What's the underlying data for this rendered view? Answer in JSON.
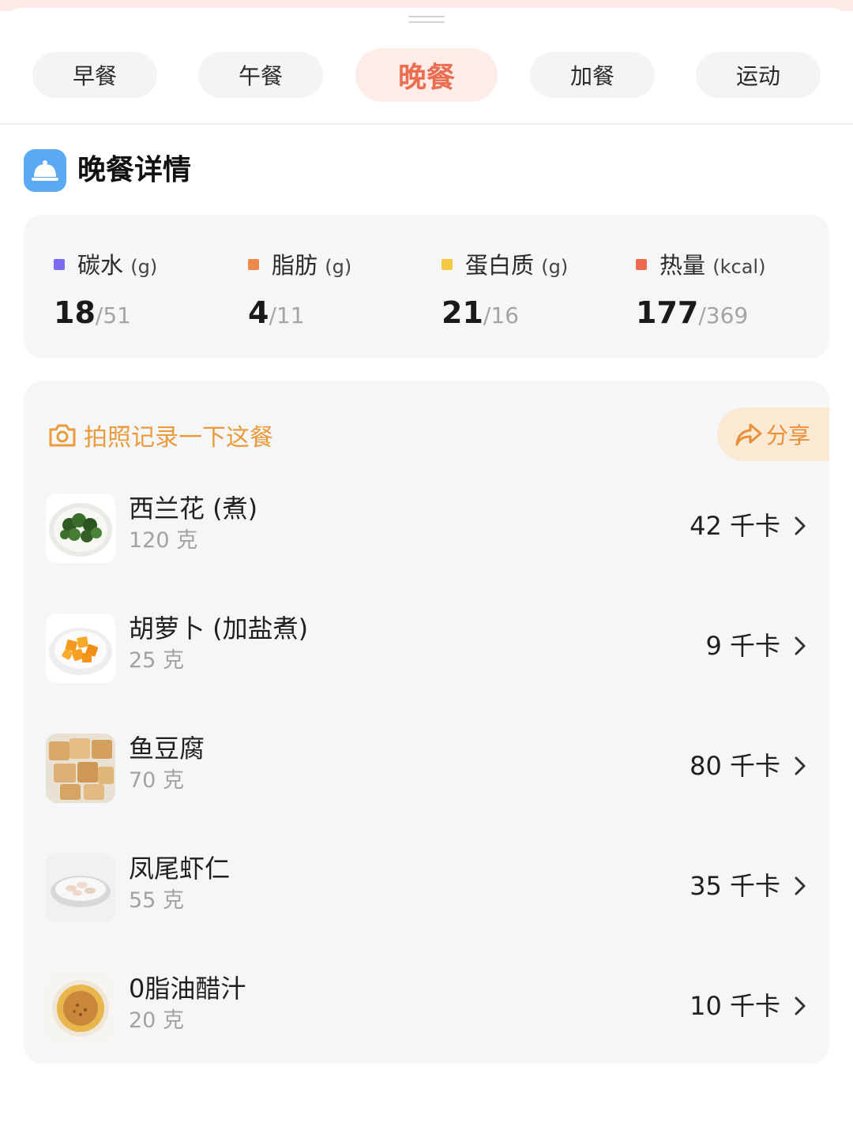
{
  "tabs": [
    {
      "label": "早餐",
      "active": false
    },
    {
      "label": "午餐",
      "active": false
    },
    {
      "label": "晚餐",
      "active": true
    },
    {
      "label": "加餐",
      "active": false
    },
    {
      "label": "运动",
      "active": false
    }
  ],
  "section": {
    "title": "晚餐详情",
    "icon": "cloche-icon",
    "icon_color": "#5aaaf3"
  },
  "macros": [
    {
      "label": "碳水",
      "unit": "(g)",
      "current": "18",
      "total": "/51",
      "color": "#7b6cf0"
    },
    {
      "label": "脂肪",
      "unit": "(g)",
      "current": "4",
      "total": "/11",
      "color": "#f08a4b"
    },
    {
      "label": "蛋白质",
      "unit": "(g)",
      "current": "21",
      "total": "/16",
      "color": "#f5c842"
    },
    {
      "label": "热量",
      "unit": "(kcal)",
      "current": "177",
      "total": "/369",
      "color": "#ee6a4f"
    }
  ],
  "photo_prompt": {
    "label": "拍照记录一下这餐",
    "icon": "camera-icon"
  },
  "share": {
    "label": "分享",
    "icon": "share-arrow-icon"
  },
  "foods": [
    {
      "name": "西兰花 (煮)",
      "weight": "120 克",
      "kcal": "42 千卡",
      "thumb": "broccoli"
    },
    {
      "name": "胡萝卜 (加盐煮)",
      "weight": "25 克",
      "kcal": "9 千卡",
      "thumb": "carrot"
    },
    {
      "name": "鱼豆腐",
      "weight": "70 克",
      "kcal": "80 千卡",
      "thumb": "fish-tofu"
    },
    {
      "name": "凤尾虾仁",
      "weight": "55 克",
      "kcal": "35 千卡",
      "thumb": "shrimp"
    },
    {
      "name": "0脂油醋汁",
      "weight": "20 克",
      "kcal": "10 千卡",
      "thumb": "vinaigrette"
    }
  ],
  "colors": {
    "accent": "#ea6f52",
    "photo_accent": "#eb9b3c",
    "card_bg": "#f5f6f8"
  }
}
